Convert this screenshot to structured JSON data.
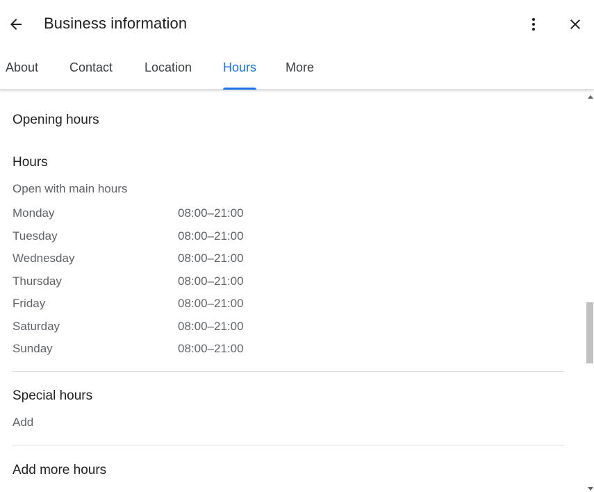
{
  "header": {
    "title": "Business information",
    "back_icon": "arrow-back-icon",
    "more_icon": "more-vert-icon",
    "close_icon": "close-icon"
  },
  "tabs": [
    {
      "label": "About",
      "active": false
    },
    {
      "label": "Contact",
      "active": false
    },
    {
      "label": "Location",
      "active": false
    },
    {
      "label": "Hours",
      "active": true
    },
    {
      "label": "More",
      "active": false
    }
  ],
  "opening_hours": {
    "title": "Opening hours",
    "hours_title": "Hours",
    "status": "Open with main hours",
    "days": [
      {
        "day": "Monday",
        "time": "08:00–21:00"
      },
      {
        "day": "Tuesday",
        "time": "08:00–21:00"
      },
      {
        "day": "Wednesday",
        "time": "08:00–21:00"
      },
      {
        "day": "Thursday",
        "time": "08:00–21:00"
      },
      {
        "day": "Friday",
        "time": "08:00–21:00"
      },
      {
        "day": "Saturday",
        "time": "08:00–21:00"
      },
      {
        "day": "Sunday",
        "time": "08:00–21:00"
      }
    ]
  },
  "special_hours": {
    "title": "Special hours",
    "action": "Add"
  },
  "more_hours": {
    "title": "Add more hours"
  },
  "colors": {
    "accent": "#1a73e8",
    "text_primary": "#202124",
    "text_secondary": "#5f6368",
    "divider": "#dadce0"
  }
}
